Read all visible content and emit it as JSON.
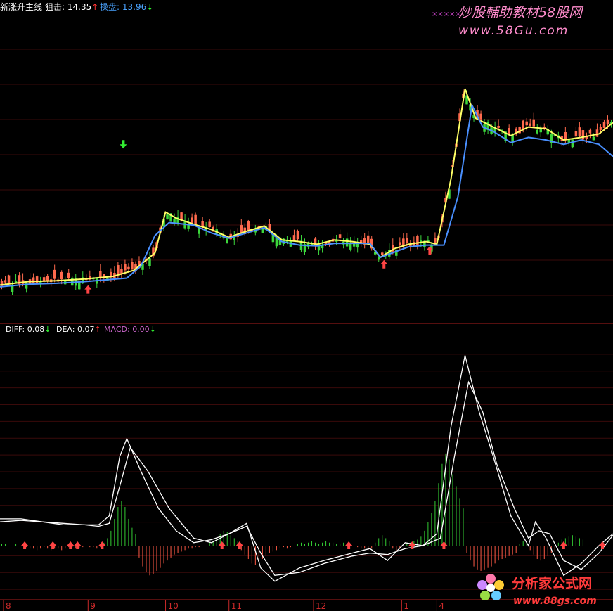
{
  "header": {
    "main": {
      "name": "新涨升主线",
      "items": [
        {
          "label": "狙击",
          "value": "14.35",
          "arrow": "↑",
          "color": "#ffffff",
          "arrow_color": "#ff3333"
        },
        {
          "label": "操盘",
          "value": "13.96",
          "arrow": "↓",
          "color": "#4aa3ff",
          "arrow_color": "#33ff33"
        }
      ]
    },
    "macd": {
      "items": [
        {
          "label": "DIFF",
          "value": "0.08",
          "arrow": "↓",
          "color": "#ffffff",
          "arrow_color": "#33ff33"
        },
        {
          "label": "DEA",
          "value": "0.07",
          "arrow": "↑",
          "color": "#ffffff",
          "arrow_color": "#ff3333"
        },
        {
          "label": "MACD",
          "value": "0.00",
          "arrow": "↓",
          "color": "#cc66cc",
          "arrow_color": "#33ff33"
        }
      ]
    }
  },
  "watermarks": {
    "top_title": "炒股輔助教材58股网",
    "top_url": "www.58Gu.com",
    "top_marker": "×××××",
    "bottom_title": "分析家公式网",
    "bottom_url": "www.88gs.com"
  },
  "colors": {
    "background": "#000000",
    "up_candle": "#ff6a4d",
    "down_candle": "#3cd73c",
    "snipe_line": "#ffff66",
    "operate_line": "#4a90ff",
    "diff_line": "#ffffff",
    "dea_line": "#ffffff",
    "macd_pos": "#33cc33",
    "macd_neg": "#ff5a46",
    "signal_up": "#ff4444",
    "signal_down": "#33ee33",
    "divider": "#aa1e1e",
    "gridline": "#3a0a0a",
    "axis_text": "#cc2a2a"
  },
  "chart_data": [
    {
      "id": "price",
      "type": "line",
      "candlestick_background": true,
      "x_range": [
        0,
        174
      ],
      "ylim": [
        12.2,
        15.6
      ],
      "grid": true,
      "series": [
        {
          "name": "狙击",
          "color": "#ffff66",
          "points": [
            [
              0,
              12.48
            ],
            [
              8,
              12.52
            ],
            [
              16,
              12.53
            ],
            [
              24,
              12.55
            ],
            [
              32,
              12.58
            ],
            [
              38,
              12.65
            ],
            [
              44,
              12.85
            ],
            [
              47,
              13.32
            ],
            [
              50,
              13.25
            ],
            [
              55,
              13.18
            ],
            [
              60,
              13.12
            ],
            [
              65,
              13.03
            ],
            [
              70,
              13.1
            ],
            [
              75,
              13.16
            ],
            [
              80,
              13.0
            ],
            [
              85,
              12.98
            ],
            [
              90,
              12.95
            ],
            [
              95,
              13.0
            ],
            [
              100,
              12.98
            ],
            [
              105,
              12.95
            ],
            [
              108,
              12.8
            ],
            [
              112,
              12.9
            ],
            [
              116,
              12.95
            ],
            [
              121,
              12.98
            ],
            [
              124,
              12.95
            ],
            [
              128,
              13.7
            ],
            [
              132,
              14.74
            ],
            [
              135,
              14.4
            ],
            [
              140,
              14.3
            ],
            [
              145,
              14.2
            ],
            [
              150,
              14.3
            ],
            [
              155,
              14.28
            ],
            [
              160,
              14.15
            ],
            [
              165,
              14.18
            ],
            [
              170,
              14.22
            ],
            [
              174,
              14.35
            ]
          ]
        },
        {
          "name": "操盘",
          "color": "#4a90ff",
          "points": [
            [
              0,
              12.46
            ],
            [
              8,
              12.49
            ],
            [
              16,
              12.5
            ],
            [
              24,
              12.52
            ],
            [
              30,
              12.54
            ],
            [
              36,
              12.56
            ],
            [
              40,
              12.7
            ],
            [
              44,
              13.05
            ],
            [
              48,
              13.2
            ],
            [
              55,
              13.17
            ],
            [
              60,
              13.08
            ],
            [
              65,
              13.02
            ],
            [
              70,
              13.08
            ],
            [
              75,
              13.14
            ],
            [
              80,
              12.98
            ],
            [
              85,
              12.94
            ],
            [
              90,
              12.93
            ],
            [
              95,
              12.96
            ],
            [
              100,
              12.96
            ],
            [
              105,
              12.96
            ],
            [
              108,
              12.8
            ],
            [
              112,
              12.86
            ],
            [
              116,
              12.92
            ],
            [
              121,
              12.94
            ],
            [
              126,
              12.94
            ],
            [
              130,
              13.5
            ],
            [
              134,
              14.55
            ],
            [
              137,
              14.3
            ],
            [
              140,
              14.25
            ],
            [
              145,
              14.12
            ],
            [
              150,
              14.18
            ],
            [
              155,
              14.15
            ],
            [
              160,
              14.1
            ],
            [
              165,
              14.15
            ],
            [
              170,
              14.1
            ],
            [
              174,
              13.96
            ]
          ]
        }
      ],
      "annotations": [
        {
          "type": "up-arrow",
          "x": 25,
          "y": 12.43
        },
        {
          "type": "up-arrow",
          "x": 109,
          "y": 12.72
        },
        {
          "type": "up-arrow",
          "x": 122,
          "y": 12.88
        },
        {
          "type": "down-arrow",
          "x": 35,
          "y": 14.1
        }
      ]
    },
    {
      "id": "macd",
      "type": "line",
      "x_range": [
        0,
        174
      ],
      "ylim": [
        -0.35,
        1.4
      ],
      "grid": true,
      "series": [
        {
          "name": "DIFF",
          "color": "#ffffff",
          "points": [
            [
              0,
              0.18
            ],
            [
              6,
              0.18
            ],
            [
              12,
              0.16
            ],
            [
              18,
              0.14
            ],
            [
              24,
              0.14
            ],
            [
              28,
              0.14
            ],
            [
              31,
              0.2
            ],
            [
              34,
              0.6
            ],
            [
              36,
              0.72
            ],
            [
              40,
              0.5
            ],
            [
              45,
              0.25
            ],
            [
              50,
              0.1
            ],
            [
              55,
              0.02
            ],
            [
              60,
              0.04
            ],
            [
              65,
              0.08
            ],
            [
              70,
              0.15
            ],
            [
              74,
              -0.15
            ],
            [
              78,
              -0.24
            ],
            [
              85,
              -0.15
            ],
            [
              92,
              -0.1
            ],
            [
              100,
              -0.05
            ],
            [
              105,
              -0.02
            ],
            [
              110,
              -0.1
            ],
            [
              115,
              0.02
            ],
            [
              120,
              0.0
            ],
            [
              124,
              0.08
            ],
            [
              128,
              0.8
            ],
            [
              132,
              1.28
            ],
            [
              136,
              0.9
            ],
            [
              140,
              0.6
            ],
            [
              145,
              0.2
            ],
            [
              150,
              0.0
            ],
            [
              152,
              0.16
            ],
            [
              155,
              0.05
            ],
            [
              160,
              -0.2
            ],
            [
              165,
              -0.12
            ],
            [
              170,
              0.0
            ],
            [
              174,
              0.08
            ]
          ]
        },
        {
          "name": "DEA",
          "color": "#ffffff",
          "points": [
            [
              0,
              0.16
            ],
            [
              6,
              0.17
            ],
            [
              12,
              0.16
            ],
            [
              18,
              0.15
            ],
            [
              24,
              0.14
            ],
            [
              28,
              0.13
            ],
            [
              31,
              0.15
            ],
            [
              34,
              0.4
            ],
            [
              37,
              0.66
            ],
            [
              42,
              0.5
            ],
            [
              48,
              0.25
            ],
            [
              55,
              0.05
            ],
            [
              60,
              0.02
            ],
            [
              65,
              0.08
            ],
            [
              70,
              0.13
            ],
            [
              74,
              -0.05
            ],
            [
              78,
              -0.2
            ],
            [
              85,
              -0.18
            ],
            [
              92,
              -0.12
            ],
            [
              100,
              -0.07
            ],
            [
              105,
              -0.05
            ],
            [
              110,
              -0.06
            ],
            [
              115,
              -0.02
            ],
            [
              120,
              0.0
            ],
            [
              125,
              0.05
            ],
            [
              129,
              0.6
            ],
            [
              133,
              1.1
            ],
            [
              137,
              0.9
            ],
            [
              141,
              0.55
            ],
            [
              146,
              0.25
            ],
            [
              150,
              0.05
            ],
            [
              153,
              0.1
            ],
            [
              156,
              0.08
            ],
            [
              160,
              -0.1
            ],
            [
              165,
              -0.16
            ],
            [
              170,
              -0.05
            ],
            [
              174,
              0.07
            ]
          ]
        }
      ],
      "histogram": {
        "name": "MACD",
        "x_start": 0,
        "x_step": 1,
        "values": [
          0.01,
          0.01,
          0.0,
          0.0,
          0.01,
          0.0,
          0.0,
          -0.01,
          -0.02,
          -0.02,
          -0.03,
          -0.02,
          -0.01,
          -0.02,
          -0.03,
          -0.02,
          -0.02,
          -0.03,
          -0.02,
          -0.01,
          -0.01,
          -0.02,
          -0.02,
          -0.01,
          0.0,
          -0.01,
          -0.01,
          -0.02,
          -0.01,
          0.02,
          0.05,
          0.1,
          0.18,
          0.26,
          0.3,
          0.26,
          0.18,
          0.12,
          0.08,
          -0.08,
          -0.14,
          -0.18,
          -0.2,
          -0.19,
          -0.17,
          -0.15,
          -0.12,
          -0.1,
          -0.08,
          -0.06,
          -0.05,
          -0.04,
          -0.03,
          -0.02,
          -0.02,
          -0.01,
          -0.01,
          0.0,
          0.0,
          0.02,
          0.03,
          0.05,
          0.08,
          0.1,
          0.09,
          0.07,
          0.05,
          0.03,
          -0.03,
          -0.06,
          -0.09,
          -0.12,
          -0.13,
          -0.11,
          -0.09,
          -0.07,
          -0.05,
          -0.04,
          -0.03,
          -0.02,
          -0.01,
          -0.02,
          -0.01,
          0.0,
          0.01,
          0.02,
          0.01,
          0.02,
          0.03,
          0.02,
          0.01,
          0.02,
          0.03,
          0.02,
          0.02,
          0.01,
          0.01,
          0.02,
          0.01,
          0.0,
          0.0,
          -0.01,
          -0.02,
          -0.02,
          -0.03,
          -0.02,
          0.02,
          0.05,
          0.07,
          0.05,
          0.03,
          -0.02,
          -0.04,
          -0.02,
          0.0,
          0.01,
          0.02,
          0.03,
          0.04,
          0.06,
          0.1,
          0.16,
          0.22,
          0.3,
          0.42,
          0.55,
          0.62,
          0.58,
          0.48,
          0.4,
          0.32,
          0.25,
          -0.05,
          -0.1,
          -0.14,
          -0.16,
          -0.17,
          -0.16,
          -0.15,
          -0.14,
          -0.12,
          -0.1,
          -0.09,
          -0.08,
          -0.07,
          -0.06,
          -0.05,
          0.01,
          0.03,
          0.02,
          -0.03,
          -0.06,
          -0.09,
          -0.1,
          -0.09,
          -0.07,
          -0.05,
          -0.04,
          0.02,
          0.04,
          0.05,
          0.06,
          0.07,
          0.06,
          0.05,
          0.04
        ]
      },
      "signals": [
        7,
        15,
        20,
        22,
        29,
        63,
        68,
        99,
        117,
        126,
        160,
        171
      ]
    }
  ],
  "x_axis": {
    "ticks": [
      {
        "label": "8",
        "x": 1
      },
      {
        "label": "9",
        "x": 25
      },
      {
        "label": "10",
        "x": 47
      },
      {
        "label": "11",
        "x": 65
      },
      {
        "label": "12",
        "x": 89
      },
      {
        "label": "1",
        "x": 114
      },
      {
        "label": "4",
        "x": 124
      }
    ]
  }
}
